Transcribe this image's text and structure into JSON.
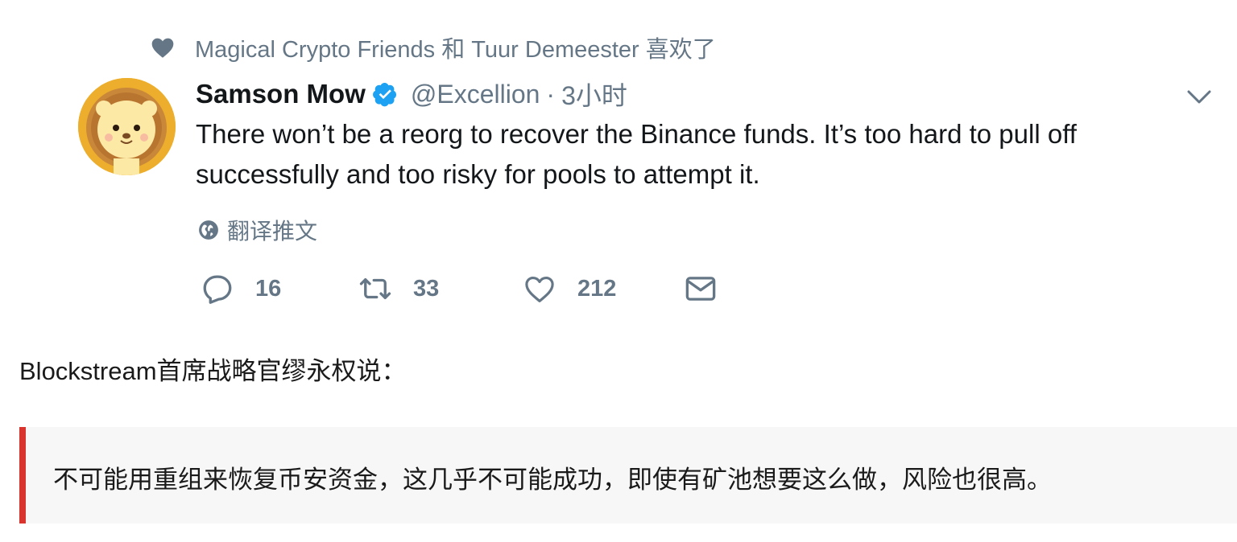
{
  "liked_by": {
    "icon": "heart-filled-icon",
    "text": "Magical Crypto Friends 和 Tuur Demeester 喜欢了"
  },
  "tweet": {
    "avatar": "lion-avatar",
    "name": "Samson Mow",
    "verified_icon": "verified-badge-icon",
    "handle": "@Excellion",
    "separator": "·",
    "time": "3小时",
    "menu_icon": "chevron-down-icon",
    "text": "There won’t be a reorg to recover the Binance funds. It’s too hard to pull off successfully and too risky for pools to attempt it.",
    "translate_label": "翻译推文",
    "actions": {
      "reply_count": "16",
      "retweet_count": "33",
      "like_count": "212"
    }
  },
  "article": {
    "caption": "Blockstream首席战略官缪永权说：",
    "quote": "不可能用重组来恢复币安资金，这几乎不可能成功，即使有矿池想要这么做，风险也很高。",
    "quote_border_color": "#d9352e"
  },
  "colors": {
    "muted": "#657786",
    "verified": "#1da1f2",
    "text": "#14171a"
  }
}
